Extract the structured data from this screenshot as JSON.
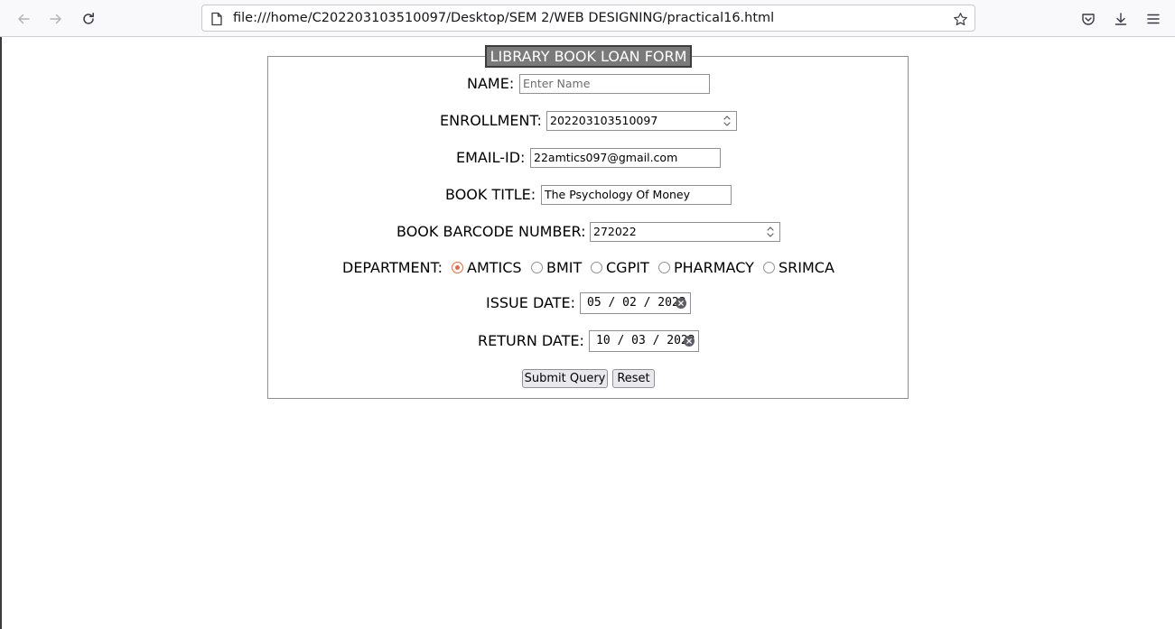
{
  "browser": {
    "url": "file:///home/C202203103510097/Desktop/SEM 2/WEB DESIGNING/practical16.html"
  },
  "form": {
    "legend": "LIBRARY BOOK LOAN FORM",
    "name": {
      "label": "NAME:",
      "placeholder": "Enter Name",
      "value": ""
    },
    "enrollment": {
      "label": "ENROLLMENT:",
      "value": "202203103510097"
    },
    "email": {
      "label": "EMAIL-ID:",
      "value": "22amtics097@gmail.com"
    },
    "book_title": {
      "label": "BOOK TITLE:",
      "value": "The Psychology Of Money"
    },
    "barcode": {
      "label": "BOOK BARCODE NUMBER:",
      "value": "272022"
    },
    "department": {
      "label": "DEPARTMENT:",
      "options": [
        "AMTICS",
        "BMIT",
        "CGPIT",
        "PHARMACY",
        "SRIMCA"
      ],
      "selected": "AMTICS"
    },
    "issue_date": {
      "label": "ISSUE DATE:",
      "value": "05 / 02 / 2023"
    },
    "return_date": {
      "label": "RETURN DATE:",
      "value": "10 / 03 / 2023"
    },
    "submit_label": "Submit Query",
    "reset_label": "Reset"
  },
  "colors": {
    "radio_accent": "#e96b3c",
    "legend_bg": "#7a7a7a"
  }
}
